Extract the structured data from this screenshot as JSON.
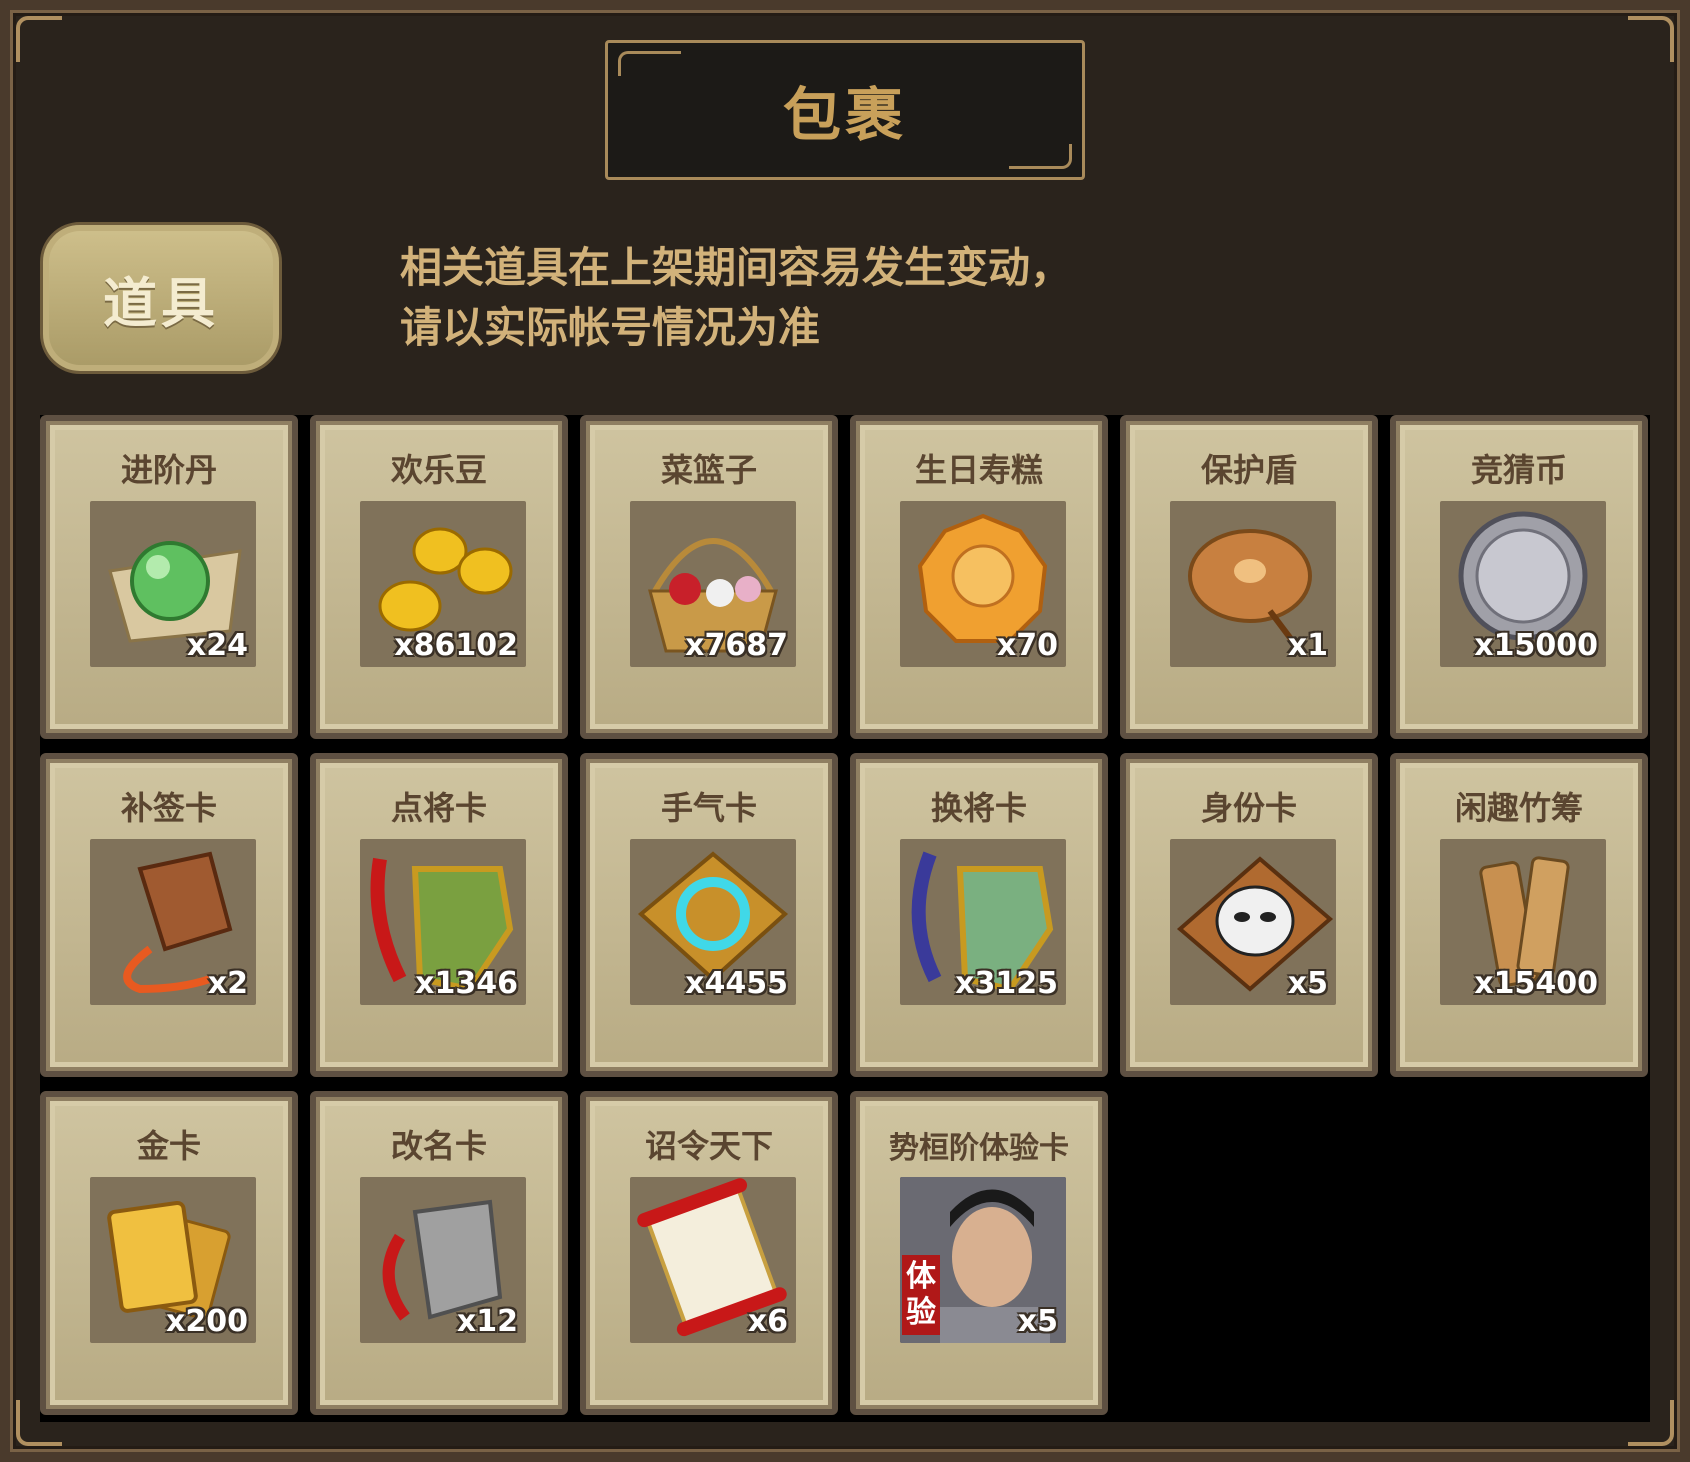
{
  "header": {
    "title": "包裹"
  },
  "tab": {
    "label": "道具"
  },
  "notice": {
    "line1": "相关道具在上架期间容易发生变动，",
    "line2": "请以实际帐号情况为准"
  },
  "items": [
    {
      "name": "进阶丹",
      "qty": "x24",
      "icon": "green-orb-icon"
    },
    {
      "name": "欢乐豆",
      "qty": "x86102",
      "icon": "gold-beans-icon"
    },
    {
      "name": "菜篮子",
      "qty": "x7687",
      "icon": "flower-basket-icon"
    },
    {
      "name": "生日寿糕",
      "qty": "x70",
      "icon": "birthday-cake-icon"
    },
    {
      "name": "保护盾",
      "qty": "x1",
      "icon": "shield-icon"
    },
    {
      "name": "竞猜币",
      "qty": "x15000",
      "icon": "silver-coin-icon"
    },
    {
      "name": "补签卡",
      "qty": "x2",
      "icon": "sign-card-icon"
    },
    {
      "name": "点将卡",
      "qty": "x1346",
      "icon": "general-card-icon"
    },
    {
      "name": "手气卡",
      "qty": "x4455",
      "icon": "luck-card-icon"
    },
    {
      "name": "换将卡",
      "qty": "x3125",
      "icon": "swap-card-icon"
    },
    {
      "name": "身份卡",
      "qty": "x5",
      "icon": "opera-mask-icon"
    },
    {
      "name": "闲趣竹筹",
      "qty": "x15400",
      "icon": "bamboo-token-icon"
    },
    {
      "name": "金卡",
      "qty": "x200",
      "icon": "gold-card-icon"
    },
    {
      "name": "改名卡",
      "qty": "x12",
      "icon": "rename-card-icon"
    },
    {
      "name": "诏令天下",
      "qty": "x6",
      "icon": "edict-scroll-icon"
    },
    {
      "name": "势桓阶体验卡",
      "qty": "x5",
      "icon": "portrait-trial-icon",
      "badge": "体验"
    }
  ]
}
